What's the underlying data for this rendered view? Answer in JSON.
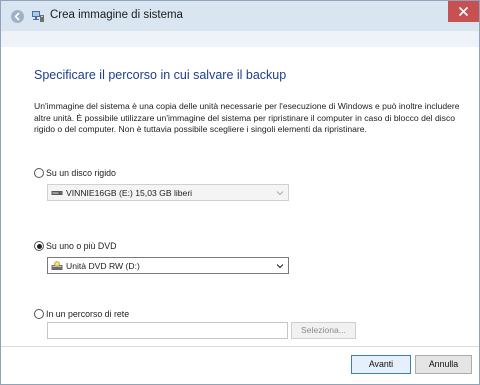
{
  "window": {
    "title": "Crea immagine di sistema"
  },
  "page": {
    "heading": "Specificare il percorso in cui salvare il backup",
    "description": "Un'immagine del sistema è una copia delle unità necessarie per l'esecuzione di Windows e può inoltre includere altre unità. È possibile utilizzare un'immagine del sistema per ripristinare il computer in caso di blocco del disco rigido o del computer. Non è tuttavia possibile scegliere i singoli elementi da ripristinare."
  },
  "options": {
    "hard_disk": {
      "label": "Su un disco rigido",
      "checked": false,
      "dropdown_value": "VINNIE16GB (E:)  15,03 GB liberi",
      "dropdown_icon": "drive-icon",
      "enabled": false
    },
    "dvd": {
      "label": "Su uno o più DVD",
      "checked": true,
      "dropdown_value": "Unità DVD RW (D:)",
      "dropdown_icon": "dvd-drive-icon",
      "enabled": true
    },
    "network": {
      "label": "In un percorso di rete",
      "checked": false,
      "path_value": "",
      "browse_label": "Seleziona...",
      "enabled": false
    }
  },
  "footer": {
    "next_label": "Avanti",
    "cancel_label": "Annulla"
  },
  "colors": {
    "titlebar": "#d9e6f2",
    "heading": "#1f3d8f",
    "close": "#c75050"
  }
}
